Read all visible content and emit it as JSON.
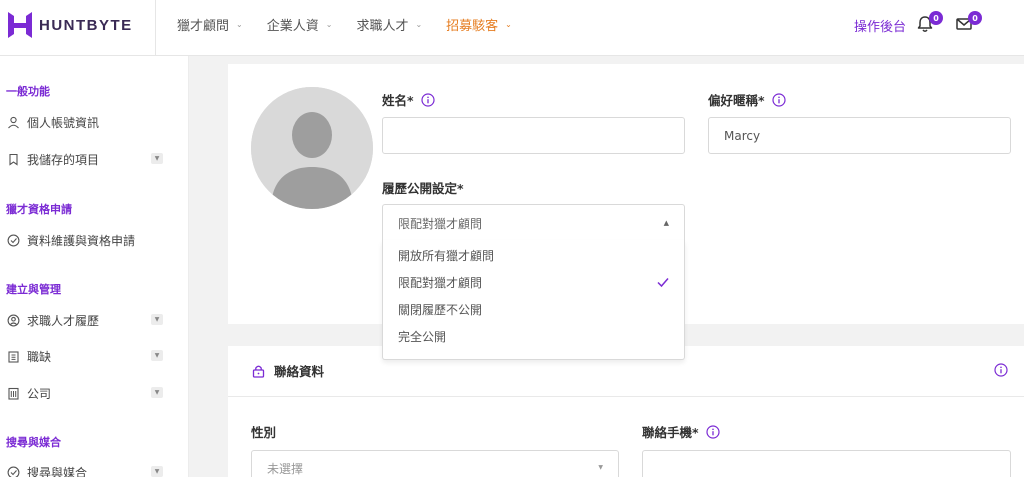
{
  "header": {
    "brand": "HUNTBYTE",
    "nav": [
      {
        "label": "獵才顧問",
        "active": false
      },
      {
        "label": "企業人資",
        "active": false
      },
      {
        "label": "求職人才",
        "active": false
      },
      {
        "label": "招募駭客",
        "active": true
      }
    ],
    "backstage": "操作後台",
    "notifications_count": "0",
    "messages_count": "0"
  },
  "sidebar": {
    "sections": [
      {
        "title": "一般功能",
        "items": [
          {
            "label": "個人帳號資訊",
            "icon": "user-icon",
            "expandable": false
          },
          {
            "label": "我儲存的項目",
            "icon": "bookmark-icon",
            "expandable": true
          }
        ]
      },
      {
        "title": "獵才資格申請",
        "items": [
          {
            "label": "資料維護與資格申請",
            "icon": "check-circle-icon",
            "expandable": false
          }
        ]
      },
      {
        "title": "建立與管理",
        "items": [
          {
            "label": "求職人才履歷",
            "icon": "user-circle-icon",
            "expandable": true
          },
          {
            "label": "職缺",
            "icon": "clipboard-icon",
            "expandable": true
          },
          {
            "label": "公司",
            "icon": "building-icon",
            "expandable": true
          }
        ]
      },
      {
        "title": "搜尋與媒合",
        "items": [
          {
            "label": "搜尋與媒合",
            "icon": "check-circle-icon",
            "expandable": true
          }
        ]
      }
    ]
  },
  "profile": {
    "name_label": "姓名*",
    "name_value": "",
    "nickname_label": "偏好暱稱*",
    "nickname_value": "Marcy",
    "visibility_label": "履歷公開設定*",
    "visibility_selected": "限配對獵才顧問",
    "visibility_options": [
      {
        "label": "開放所有獵才顧問",
        "selected": false
      },
      {
        "label": "限配對獵才顧問",
        "selected": true
      },
      {
        "label": "關閉履歷不公開",
        "selected": false
      },
      {
        "label": "完全公開",
        "selected": false
      }
    ]
  },
  "contact": {
    "title": "聯絡資料",
    "gender_label": "性別",
    "gender_value": "未選擇",
    "phone_label": "聯絡手機*",
    "phone_value": ""
  },
  "colors": {
    "brand_purple": "#7b2bd4",
    "active_nav_orange": "#e67e22",
    "logo_text": "#3a2a55"
  }
}
